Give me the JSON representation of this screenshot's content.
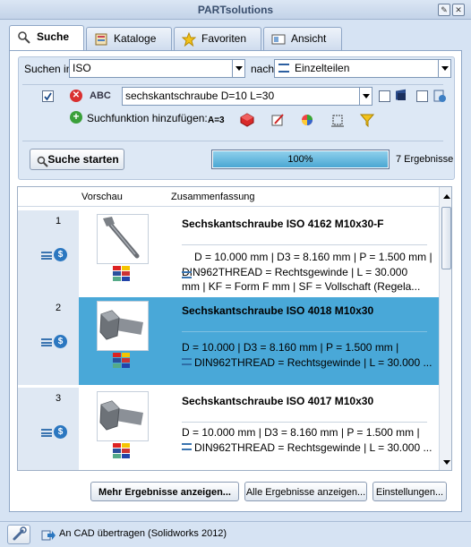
{
  "window": {
    "title": "PARTsolutions"
  },
  "tabs": [
    {
      "label": "Suche",
      "icon": "search-icon",
      "active": true
    },
    {
      "label": "Kataloge",
      "icon": "catalog-icon",
      "active": false
    },
    {
      "label": "Favoriten",
      "icon": "star-icon",
      "active": false
    },
    {
      "label": "Ansicht",
      "icon": "view-icon",
      "active": false
    }
  ],
  "search": {
    "scope_label": "Suchen in",
    "scope_value": "ISO",
    "type_label": "nach",
    "type_value": "Einzelteilen",
    "abc_label": "ABC",
    "query_value": "sechskantschraube D=10 L=30",
    "add_function_label": "Suchfunktion hinzufügen:",
    "a3_label": "A=3",
    "start_button": "Suche starten",
    "progress_percent": 100,
    "progress_text": "100%",
    "result_count": "7 Ergebnisse"
  },
  "results": {
    "columns": [
      "Vorschau",
      "Zusammenfassung"
    ],
    "rows": [
      {
        "number": "1",
        "title": "Sechskantschraube ISO 4162 M10x30-F",
        "line1": "D = 10.000 mm | D3 = 8.160 mm | P = 1.500 mm |",
        "line2": "DIN962THREAD = Rechtsgewinde | L = 30.000",
        "line3": "mm | KF = Form F mm | SF = Vollschaft (Regela...",
        "selected": false,
        "thumb": "long-bolt"
      },
      {
        "number": "2",
        "title": "Sechskantschraube ISO 4018 M10x30",
        "line1": "D = 10.000 | D3 = 8.160 mm | P = 1.500 mm |",
        "line2": "DIN962THREAD = Rechtsgewinde | L = 30.000 ...",
        "line3": "",
        "selected": true,
        "thumb": "hex-bolt"
      },
      {
        "number": "3",
        "title": "Sechskantschraube ISO 4017 M10x30",
        "line1": "D = 10.000 mm | D3 = 8.160 mm | P = 1.500 mm |",
        "line2": "DIN962THREAD = Rechtsgewinde | L = 30.000 ...",
        "line3": "",
        "selected": false,
        "thumb": "hex-bolt"
      }
    ]
  },
  "buttons": {
    "more_results": "Mehr Ergebnisse anzeigen...",
    "all_results": "Alle Ergebnisse anzeigen...",
    "settings": "Einstellungen..."
  },
  "status": {
    "transfer_label": "An CAD übertragen (Solidworks 2012)"
  }
}
